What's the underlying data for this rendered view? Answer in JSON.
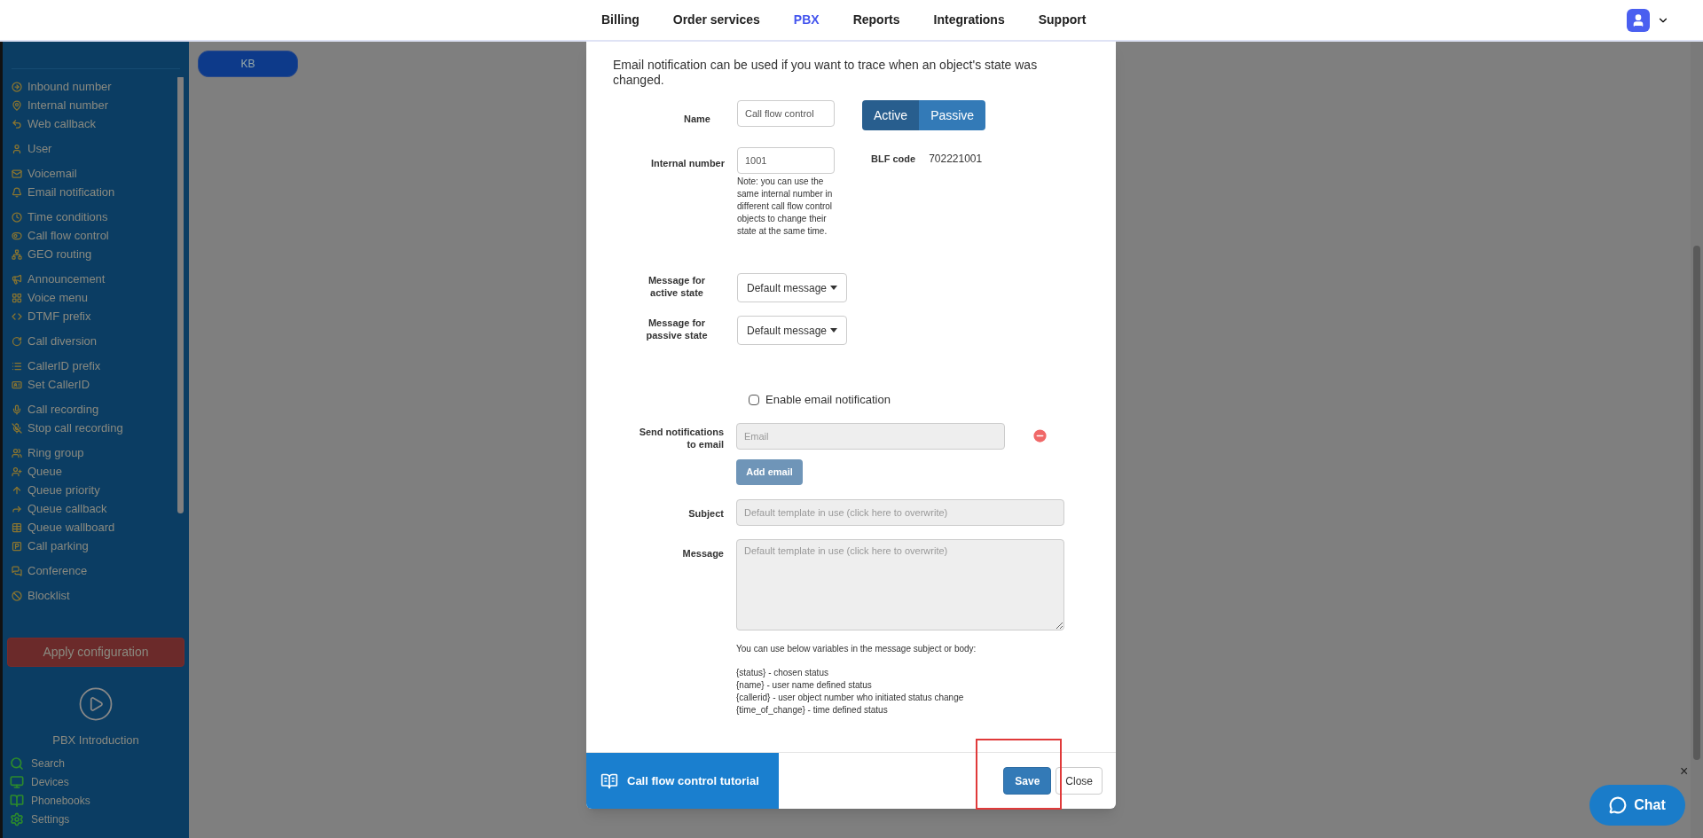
{
  "nav": {
    "items": [
      {
        "label": "Billing",
        "selected": false
      },
      {
        "label": "Order services",
        "selected": false
      },
      {
        "label": "PBX",
        "selected": true
      },
      {
        "label": "Reports",
        "selected": false
      },
      {
        "label": "Integrations",
        "selected": false
      },
      {
        "label": "Support",
        "selected": false
      }
    ]
  },
  "sidebar": {
    "groups": [
      [
        "Inbound number",
        "Internal number",
        "Web callback"
      ],
      [
        "User"
      ],
      [
        "Voicemail",
        "Email notification"
      ],
      [
        "Time conditions",
        "Call flow control",
        "GEO routing"
      ],
      [
        "Announcement",
        "Voice menu",
        "DTMF prefix"
      ],
      [
        "Call diversion"
      ],
      [
        "CallerID prefix",
        "Set CallerID"
      ],
      [
        "Call recording",
        "Stop call recording"
      ],
      [
        "Ring group",
        "Queue",
        "Queue priority",
        "Queue callback",
        "Queue wallboard",
        "Call parking"
      ],
      [
        "Conference"
      ],
      [
        "Blocklist"
      ]
    ],
    "apply_button": "Apply configuration",
    "intro_label": "PBX Introduction",
    "links": [
      "Search",
      "Devices",
      "Phonebooks",
      "Settings"
    ]
  },
  "toolbar": {
    "button": "KB"
  },
  "modal": {
    "intro": "Email notification can be used if you want to trace when an object's state was changed.",
    "name": {
      "label": "Name",
      "value": "Call flow control"
    },
    "state_toggle": [
      {
        "label": "Active",
        "selected": true
      },
      {
        "label": "Passive",
        "selected": false
      }
    ],
    "internal": {
      "label": "Internal number",
      "value": "1001",
      "note": "Note: you can use the same internal number in different call flow control objects to change their state at the same time."
    },
    "blf": {
      "label": "BLF code",
      "value": "702221001"
    },
    "message_active": {
      "label": "Message for active state",
      "value": "Default message"
    },
    "message_passive": {
      "label": "Message for passive state",
      "value": "Default message"
    },
    "email_enabled": {
      "label": "Enable email notification",
      "checked": false
    },
    "send_to": {
      "label": "Send notifications to email",
      "placeholder": "Email",
      "button": "Add email"
    },
    "subject": {
      "label": "Subject",
      "placeholder": "Default template in use (click here to overwrite)"
    },
    "message": {
      "label": "Message",
      "placeholder": "Default template in use (click here to overwrite)"
    },
    "variables_intro": "You can use below variables in the message subject or body:",
    "variables": [
      "{status} - chosen status",
      "{name} - user name defined status",
      "{callerid} - user object number who initiated status change",
      "{time_of_change} - time defined status"
    ],
    "tutorial": "Call flow control tutorial",
    "save": "Save",
    "close": "Close"
  },
  "chat": {
    "label": "Chat",
    "close": "×"
  }
}
